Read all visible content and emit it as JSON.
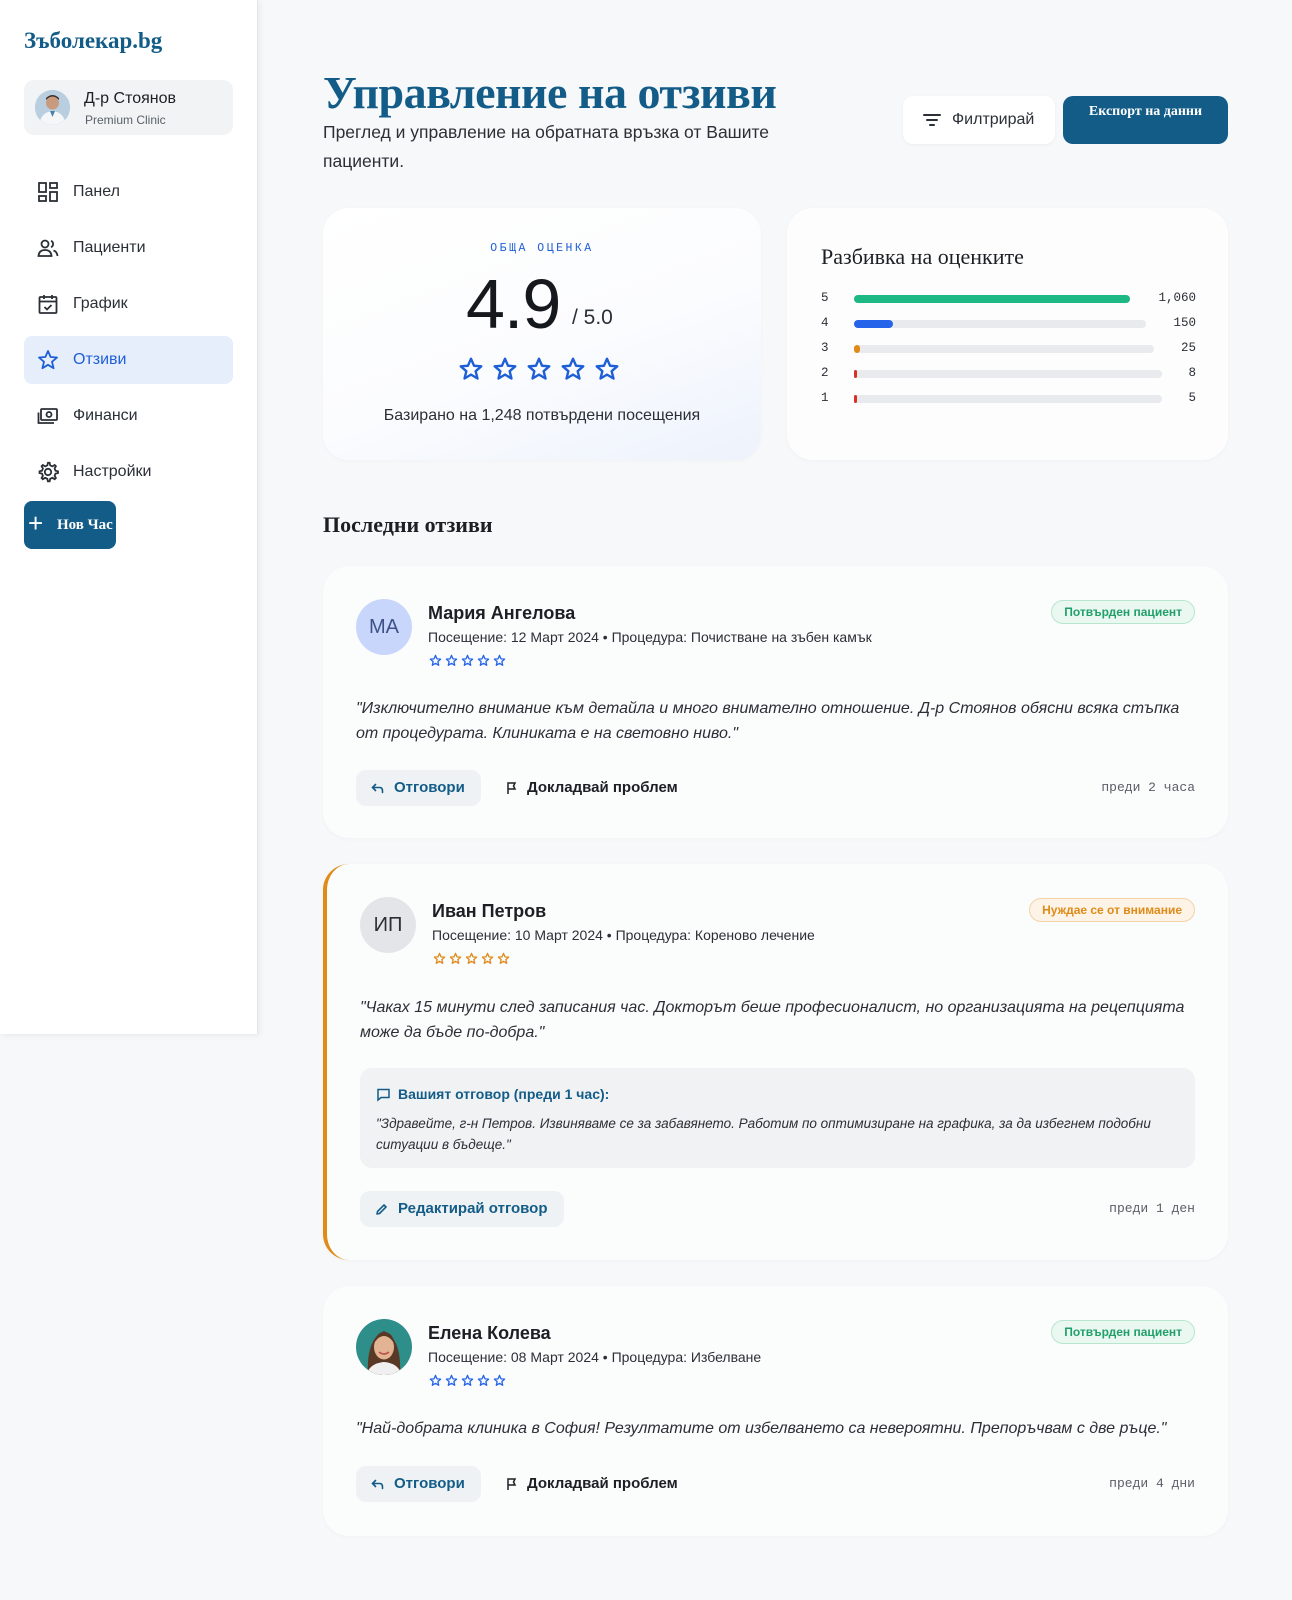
{
  "app": {
    "logo": "Зъболекар.bg"
  },
  "profile": {
    "name": "Д-р Стоянов",
    "subtitle": "Premium Clinic"
  },
  "nav": {
    "items": [
      {
        "label": "Панел",
        "icon": "dashboard-icon"
      },
      {
        "label": "Пациенти",
        "icon": "patients-icon"
      },
      {
        "label": "График",
        "icon": "calendar-icon"
      },
      {
        "label": "Отзиви",
        "icon": "star-icon",
        "active": true
      },
      {
        "label": "Финанси",
        "icon": "finance-icon"
      },
      {
        "label": "Настройки",
        "icon": "gear-icon"
      }
    ],
    "new_button": "Нов Час"
  },
  "header": {
    "title": "Управление на отзиви",
    "subtitle": "Преглед и управление на обратната връзка от Вашите пациенти.",
    "filter_label": "Филтрирай",
    "export_label": "Експорт на данни"
  },
  "overall": {
    "caption": "ОБЩА ОЦЕНКА",
    "score": "4.9",
    "out_of": "/ 5.0",
    "stars": 5,
    "based_on": "Базирано на 1,248 потвърдени посещения"
  },
  "breakdown": {
    "title": "Разбивка на оценките",
    "rows": [
      {
        "star": "5",
        "count": "1,060",
        "fraction": 0.85,
        "color": "#1db884"
      },
      {
        "star": "4",
        "count": "150",
        "fraction": 0.12,
        "color": "#2563eb"
      },
      {
        "star": "3",
        "count": "25",
        "fraction": 0.02,
        "color": "#e08a18"
      },
      {
        "star": "2",
        "count": "8",
        "fraction": 0.007,
        "color": "#d93025"
      },
      {
        "star": "1",
        "count": "5",
        "fraction": 0.004,
        "color": "#d93025"
      }
    ]
  },
  "reviews_section": {
    "title": "Последни отзиви"
  },
  "reviews": [
    {
      "initials": "МА",
      "name": "Мария Ангелова",
      "meta": "Посещение: 12 Март 2024 • Процедура: Почистване на зъбен камък",
      "badge": "Потвърден пациент",
      "text": "\"Изключително внимание към детайла и много внимателно отношение. Д-р Стоянов обясни всяка стъпка от процедурата. Клиниката е на световно ниво.\"",
      "reply_label": "Отговори",
      "report_label": "Докладвай проблем",
      "ago": "преди 2 часа"
    },
    {
      "initials": "ИП",
      "name": "Иван Петров",
      "meta": "Посещение: 10 Март 2024 • Процедура: Кореново лечение",
      "badge": "Нуждае се от внимание",
      "text": "\"Чаках 15 минути след записания час. Докторът беше професионалист, но организацията на рецепцията може да бъде по-добра.\"",
      "reply_header": "Вашият отговор (преди 1 час):",
      "reply_text": "\"Здравейте, г-н Петров. Извиняваме се за забавянето. Работим по оптимизиране на графика, за да избегнем подобни ситуации в бъдеще.\"",
      "edit_label": "Редактирай отговор",
      "ago": "преди 1 ден"
    },
    {
      "name": "Елена Колева",
      "meta": "Посещение: 08 Март 2024 • Процедура: Избелване",
      "badge": "Потвърден пациент",
      "text": "\"Най-добрата клиника в София! Резултатите от избелването са невероятни. Препоръчвам с две ръце.\"",
      "reply_label": "Отговори",
      "report_label": "Докладвай проблем",
      "ago": "преди 4 дни"
    }
  ]
}
